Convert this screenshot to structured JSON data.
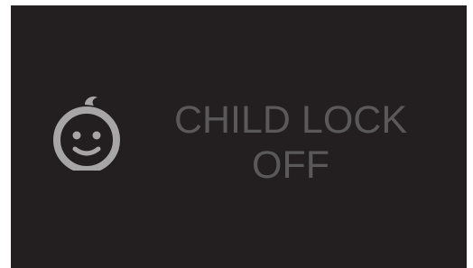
{
  "display": {
    "title": "CHILD LOCK",
    "state": "OFF",
    "icon": "baby-face-icon",
    "background_color": "#231f20",
    "text_color": "#5a5859",
    "icon_color": "#a7a5a6"
  }
}
